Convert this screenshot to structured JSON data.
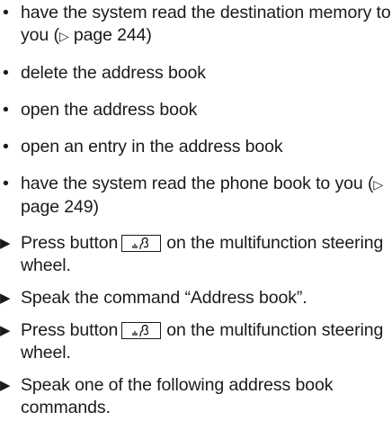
{
  "bullets": [
    {
      "mark": "•",
      "text": "have the system read the destination memory to you (",
      "ref_symbol": "▷",
      "ref_text": " page 244)"
    },
    {
      "mark": "•",
      "text": "delete the address book"
    },
    {
      "mark": "•",
      "text": "open the address book"
    },
    {
      "mark": "•",
      "text": "open an entry in the address book"
    },
    {
      "mark": "•",
      "text": "have the system read the phone book to you (",
      "ref_symbol": "▷",
      "ref_text": " page 249)"
    }
  ],
  "steps": [
    {
      "mark": "▶",
      "before": "Press button",
      "after": "on the multifunction steering wheel.",
      "icon": "voice-control-icon"
    },
    {
      "mark": "▶",
      "text": "Speak the command “Address book”."
    },
    {
      "mark": "▶",
      "before": "Press button",
      "after": "on the multifunction steering wheel.",
      "icon": "voice-control-icon"
    },
    {
      "mark": "▶",
      "text": "Speak one of the following address book commands."
    }
  ]
}
